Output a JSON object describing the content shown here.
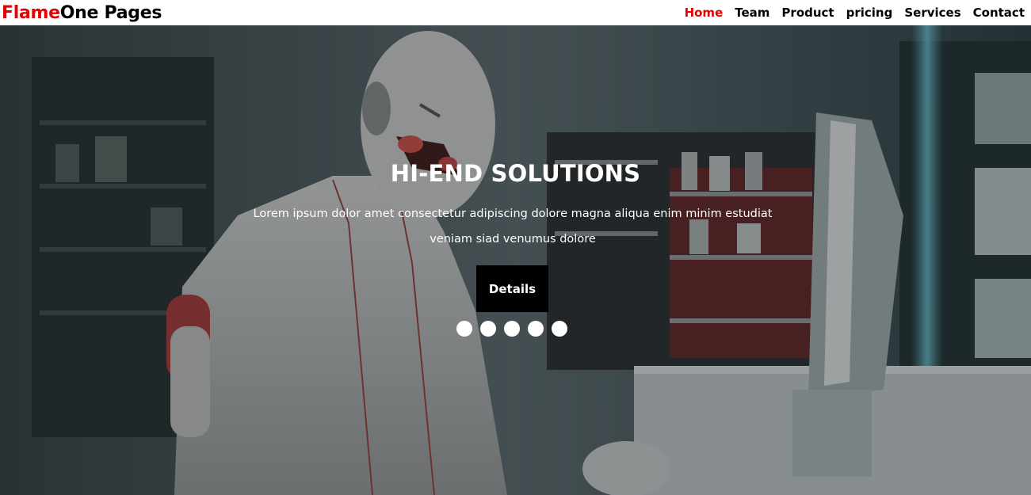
{
  "brand": {
    "accent": "Flame",
    "rest": "One Pages"
  },
  "nav": {
    "items": [
      "Home",
      "Team",
      "Product",
      "pricing",
      "Services",
      "Contact"
    ],
    "active": "Home"
  },
  "hero": {
    "title": "HI-END SOLUTIONS",
    "text": "Lorem ipsum dolor amet consectetur adipiscing dolore magna aliqua enim minim estudiat veniam siad venumus dolore",
    "button_label": "Details",
    "dot_count": 5,
    "image_subject": "robot-pharmacist"
  },
  "colors": {
    "accent": "#e60000",
    "nav_text": "#000000",
    "button_bg": "#000000",
    "hero_text": "#ffffff"
  }
}
